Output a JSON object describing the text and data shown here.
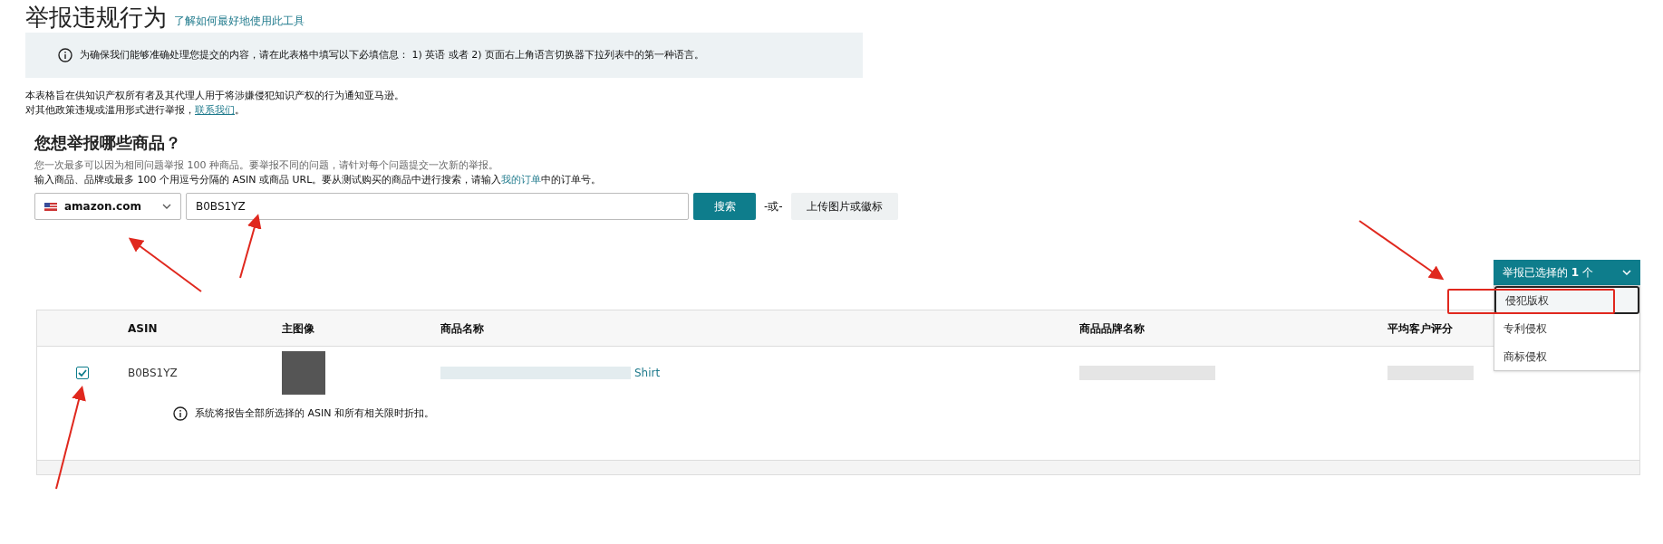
{
  "title": "举报违规行为",
  "help_link": "了解如何最好地使用此工具",
  "notice": "为确保我们能够准确处理您提交的内容，请在此表格中填写以下必填信息： 1) 英语 或者 2) 页面右上角语言切换器下拉列表中的第一种语言。",
  "intro": [
    "本表格旨在供知识产权所有者及其代理人用于将涉嫌侵犯知识产权的行为通知亚马逊。"
  ],
  "other_prefix": "对其他政策违规或滥用形式进行举报，",
  "contact_link": "联系我们",
  "other_suffix": "。",
  "section_title": "您想举报哪些商品？",
  "hint": "您一次最多可以因为相同问题举报 100 种商品。要举报不同的问题，请针对每个问题提交一次新的举报。",
  "search_hint_prefix": "输入商品、品牌或最多 100 个用逗号分隔的 ASIN 或商品 URL。要从测试购买的商品中进行搜索，请输入",
  "orders_link": "我的订单",
  "search_hint_suffix": "中的订单号。",
  "marketplace": "amazon.com",
  "search_value": "B0BS1YZ",
  "search_button": "搜索",
  "or": "-或-",
  "upload_button": "上传图片或徽标",
  "report_button": "举报已选择的 **1** 个",
  "report_menu": [
    {
      "label": "侵犯版权",
      "selected": true
    },
    {
      "label": "专利侵权",
      "selected": false
    },
    {
      "label": "商标侵权",
      "selected": false
    }
  ],
  "table": {
    "columns": [
      "ASIN",
      "主图像",
      "商品名称",
      "商品品牌名称",
      "平均客户评分"
    ],
    "rows": [
      {
        "checked": true,
        "asin": "B0BS1YZ",
        "name": "Shirt"
      }
    ],
    "note": "系统将报告全部所选择的 ASIN 和所有相关限时折扣。"
  }
}
